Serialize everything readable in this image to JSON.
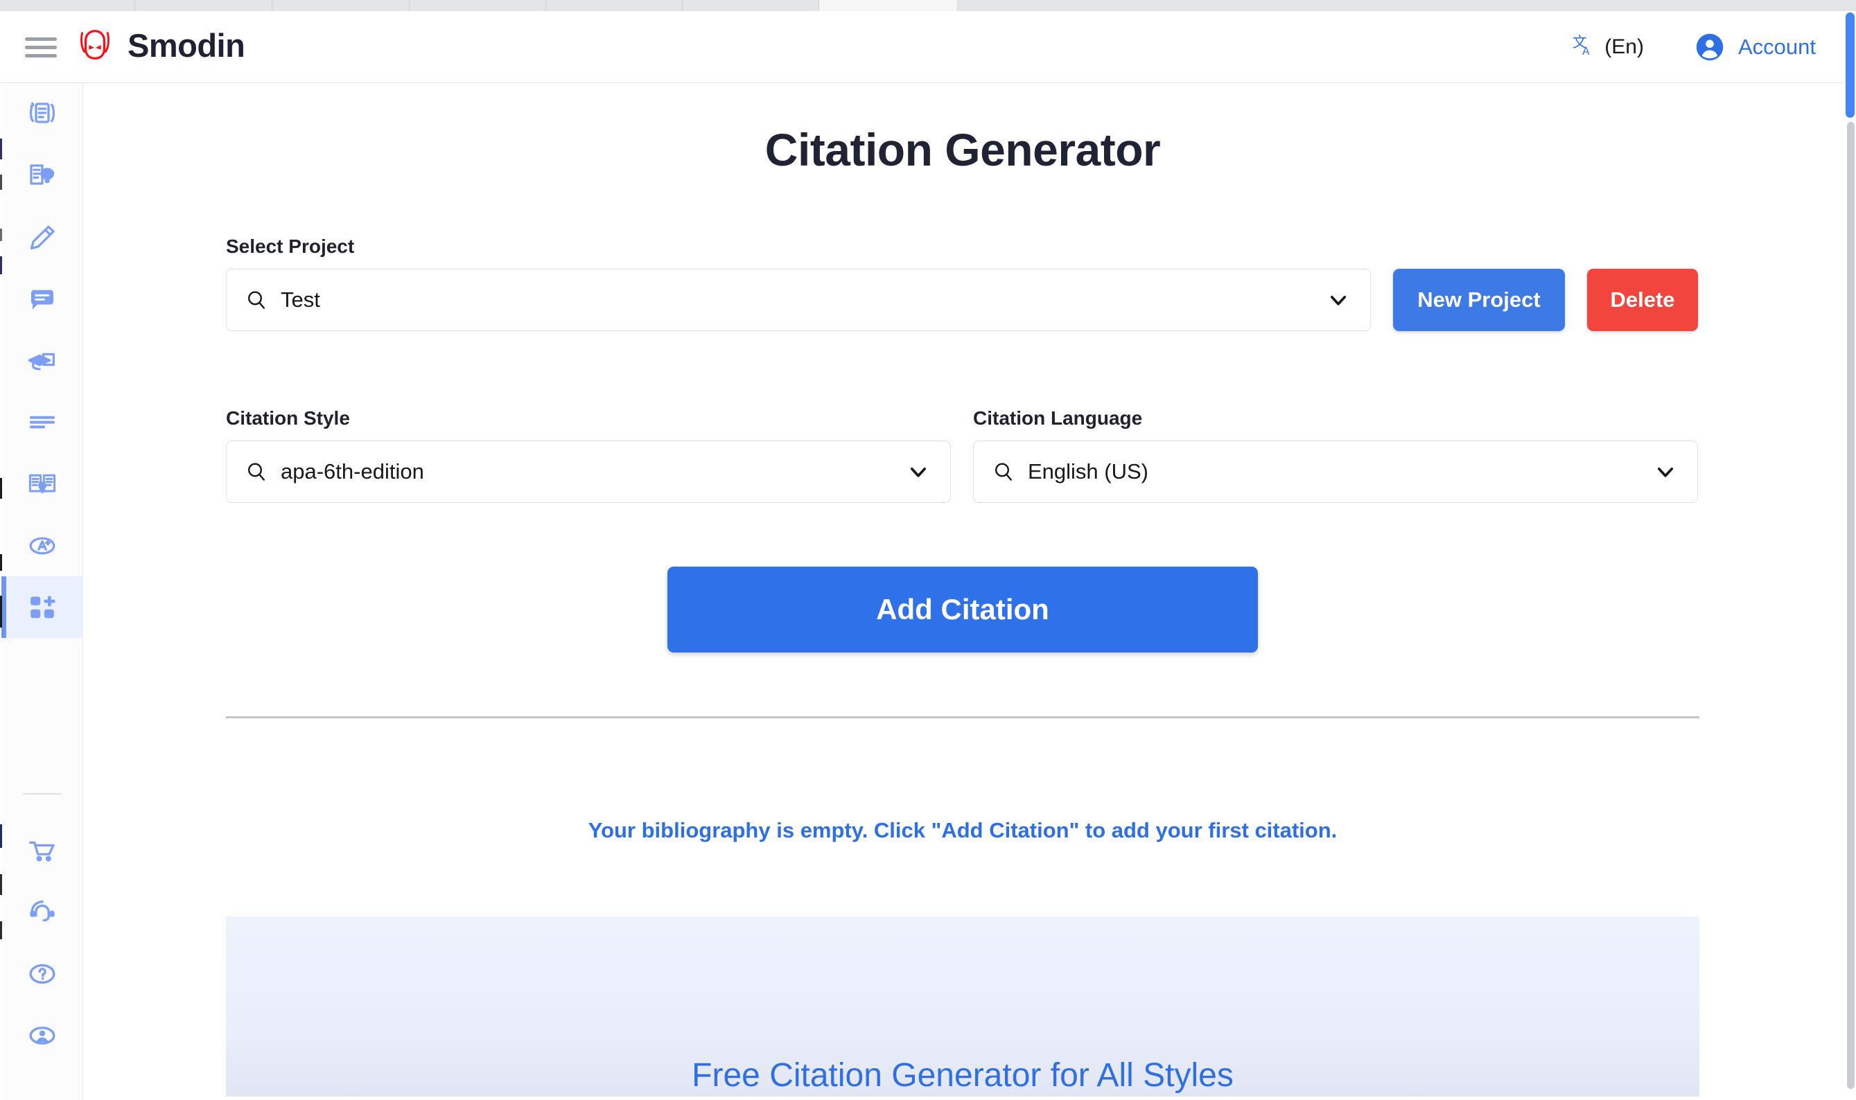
{
  "header": {
    "brand_name": "Smodin",
    "brand_icon": "smodin-robot-logo",
    "menu_icon": "hamburger-menu-icon",
    "language_icon": "translate-icon",
    "language_label": "(En)",
    "account_icon": "account-avatar-icon",
    "account_label": "Account"
  },
  "sidebar": {
    "items": [
      {
        "icon": "document-rewrite-icon",
        "name": "sidebar-item-rewriter",
        "active": false
      },
      {
        "icon": "plagiarism-check-icon",
        "name": "sidebar-item-plagiarism-checker",
        "active": false
      },
      {
        "icon": "pencil-writer-icon",
        "name": "sidebar-item-ai-writer",
        "active": false
      },
      {
        "icon": "chat-bubble-icon",
        "name": "sidebar-item-ai-chat",
        "active": false
      },
      {
        "icon": "graduation-cap-icon",
        "name": "sidebar-item-homework-helper",
        "active": false
      },
      {
        "icon": "summarize-lines-icon",
        "name": "sidebar-item-summarizer",
        "active": false
      },
      {
        "icon": "open-book-translate-icon",
        "name": "sidebar-item-translator",
        "active": false
      },
      {
        "icon": "grammar-a-plus-icon",
        "name": "sidebar-item-grader",
        "active": false
      },
      {
        "icon": "add-tiles-icon",
        "name": "sidebar-item-citation-generator",
        "active": true
      }
    ],
    "footer_items": [
      {
        "icon": "shopping-cart-icon",
        "name": "sidebar-item-pricing"
      },
      {
        "icon": "headset-support-icon",
        "name": "sidebar-item-support"
      },
      {
        "icon": "question-mark-circle-icon",
        "name": "sidebar-item-help"
      },
      {
        "icon": "user-profile-icon",
        "name": "sidebar-item-profile"
      }
    ]
  },
  "main": {
    "page_title": "Citation Generator",
    "project": {
      "label": "Select Project",
      "value": "Test",
      "search_icon": "search-icon",
      "chevron_icon": "chevron-down-icon",
      "new_project_label": "New Project",
      "delete_label": "Delete"
    },
    "citation_style": {
      "label": "Citation Style",
      "value": "apa-6th-edition",
      "search_icon": "search-icon",
      "chevron_icon": "chevron-down-icon"
    },
    "citation_language": {
      "label": "Citation Language",
      "value": "English (US)",
      "search_icon": "search-icon",
      "chevron_icon": "chevron-down-icon"
    },
    "add_citation_label": "Add Citation",
    "empty_message": "Your bibliography is empty. Click \"Add Citation\" to add your first citation.",
    "promo_title": "Free Citation Generator for All Styles"
  },
  "colors": {
    "primary_blue": "#2f71e8",
    "secondary_blue": "#3d7ae5",
    "danger_red": "#f2453d",
    "link_blue": "#2f6fe4",
    "brand_red": "#ff0f15",
    "sidebar_icon": "#7d9ef5",
    "active_bg": "#eaf0fd",
    "title_dark": "#1f2333"
  }
}
